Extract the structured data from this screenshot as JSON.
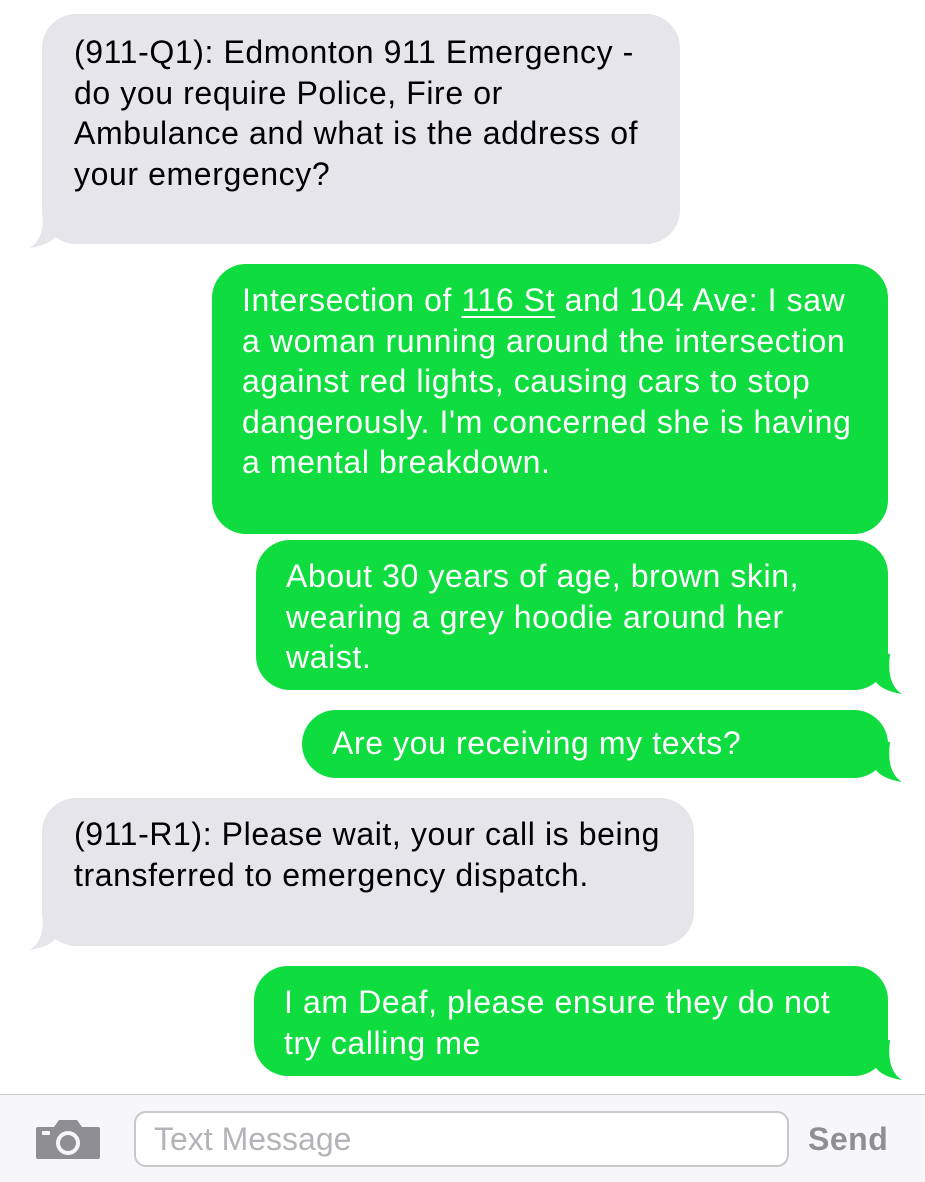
{
  "colors": {
    "incoming_bubble": "#e5e5ea",
    "outgoing_bubble": "#0fdc3f",
    "outgoing_text": "#ffffff",
    "send_disabled": "#8e8e93"
  },
  "messages": [
    {
      "direction": "incoming",
      "text": "(911-Q1): Edmonton 911 Emergency - do you require Police, Fire or Ambulance and what is the address of your emergency?"
    },
    {
      "direction": "outgoing",
      "text_before_link": "Intersection of ",
      "link_text": "116 St",
      "text_after_link": " and 104 Ave: I saw a woman running around the intersection against red lights, causing cars to stop dangerously. I'm concerned she is having a mental breakdown."
    },
    {
      "direction": "outgoing",
      "text": "About 30 years of age, brown skin, wearing a grey hoodie around her waist."
    },
    {
      "direction": "outgoing",
      "text": "Are you receiving my texts?"
    },
    {
      "direction": "incoming",
      "text": "(911-R1): Please wait, your call is being transferred to emergency dispatch."
    },
    {
      "direction": "outgoing",
      "text": "I am Deaf, please ensure they do not try calling me"
    }
  ],
  "input_bar": {
    "camera_icon": "camera-icon",
    "placeholder": "Text Message",
    "value": "",
    "send_label": "Send"
  }
}
